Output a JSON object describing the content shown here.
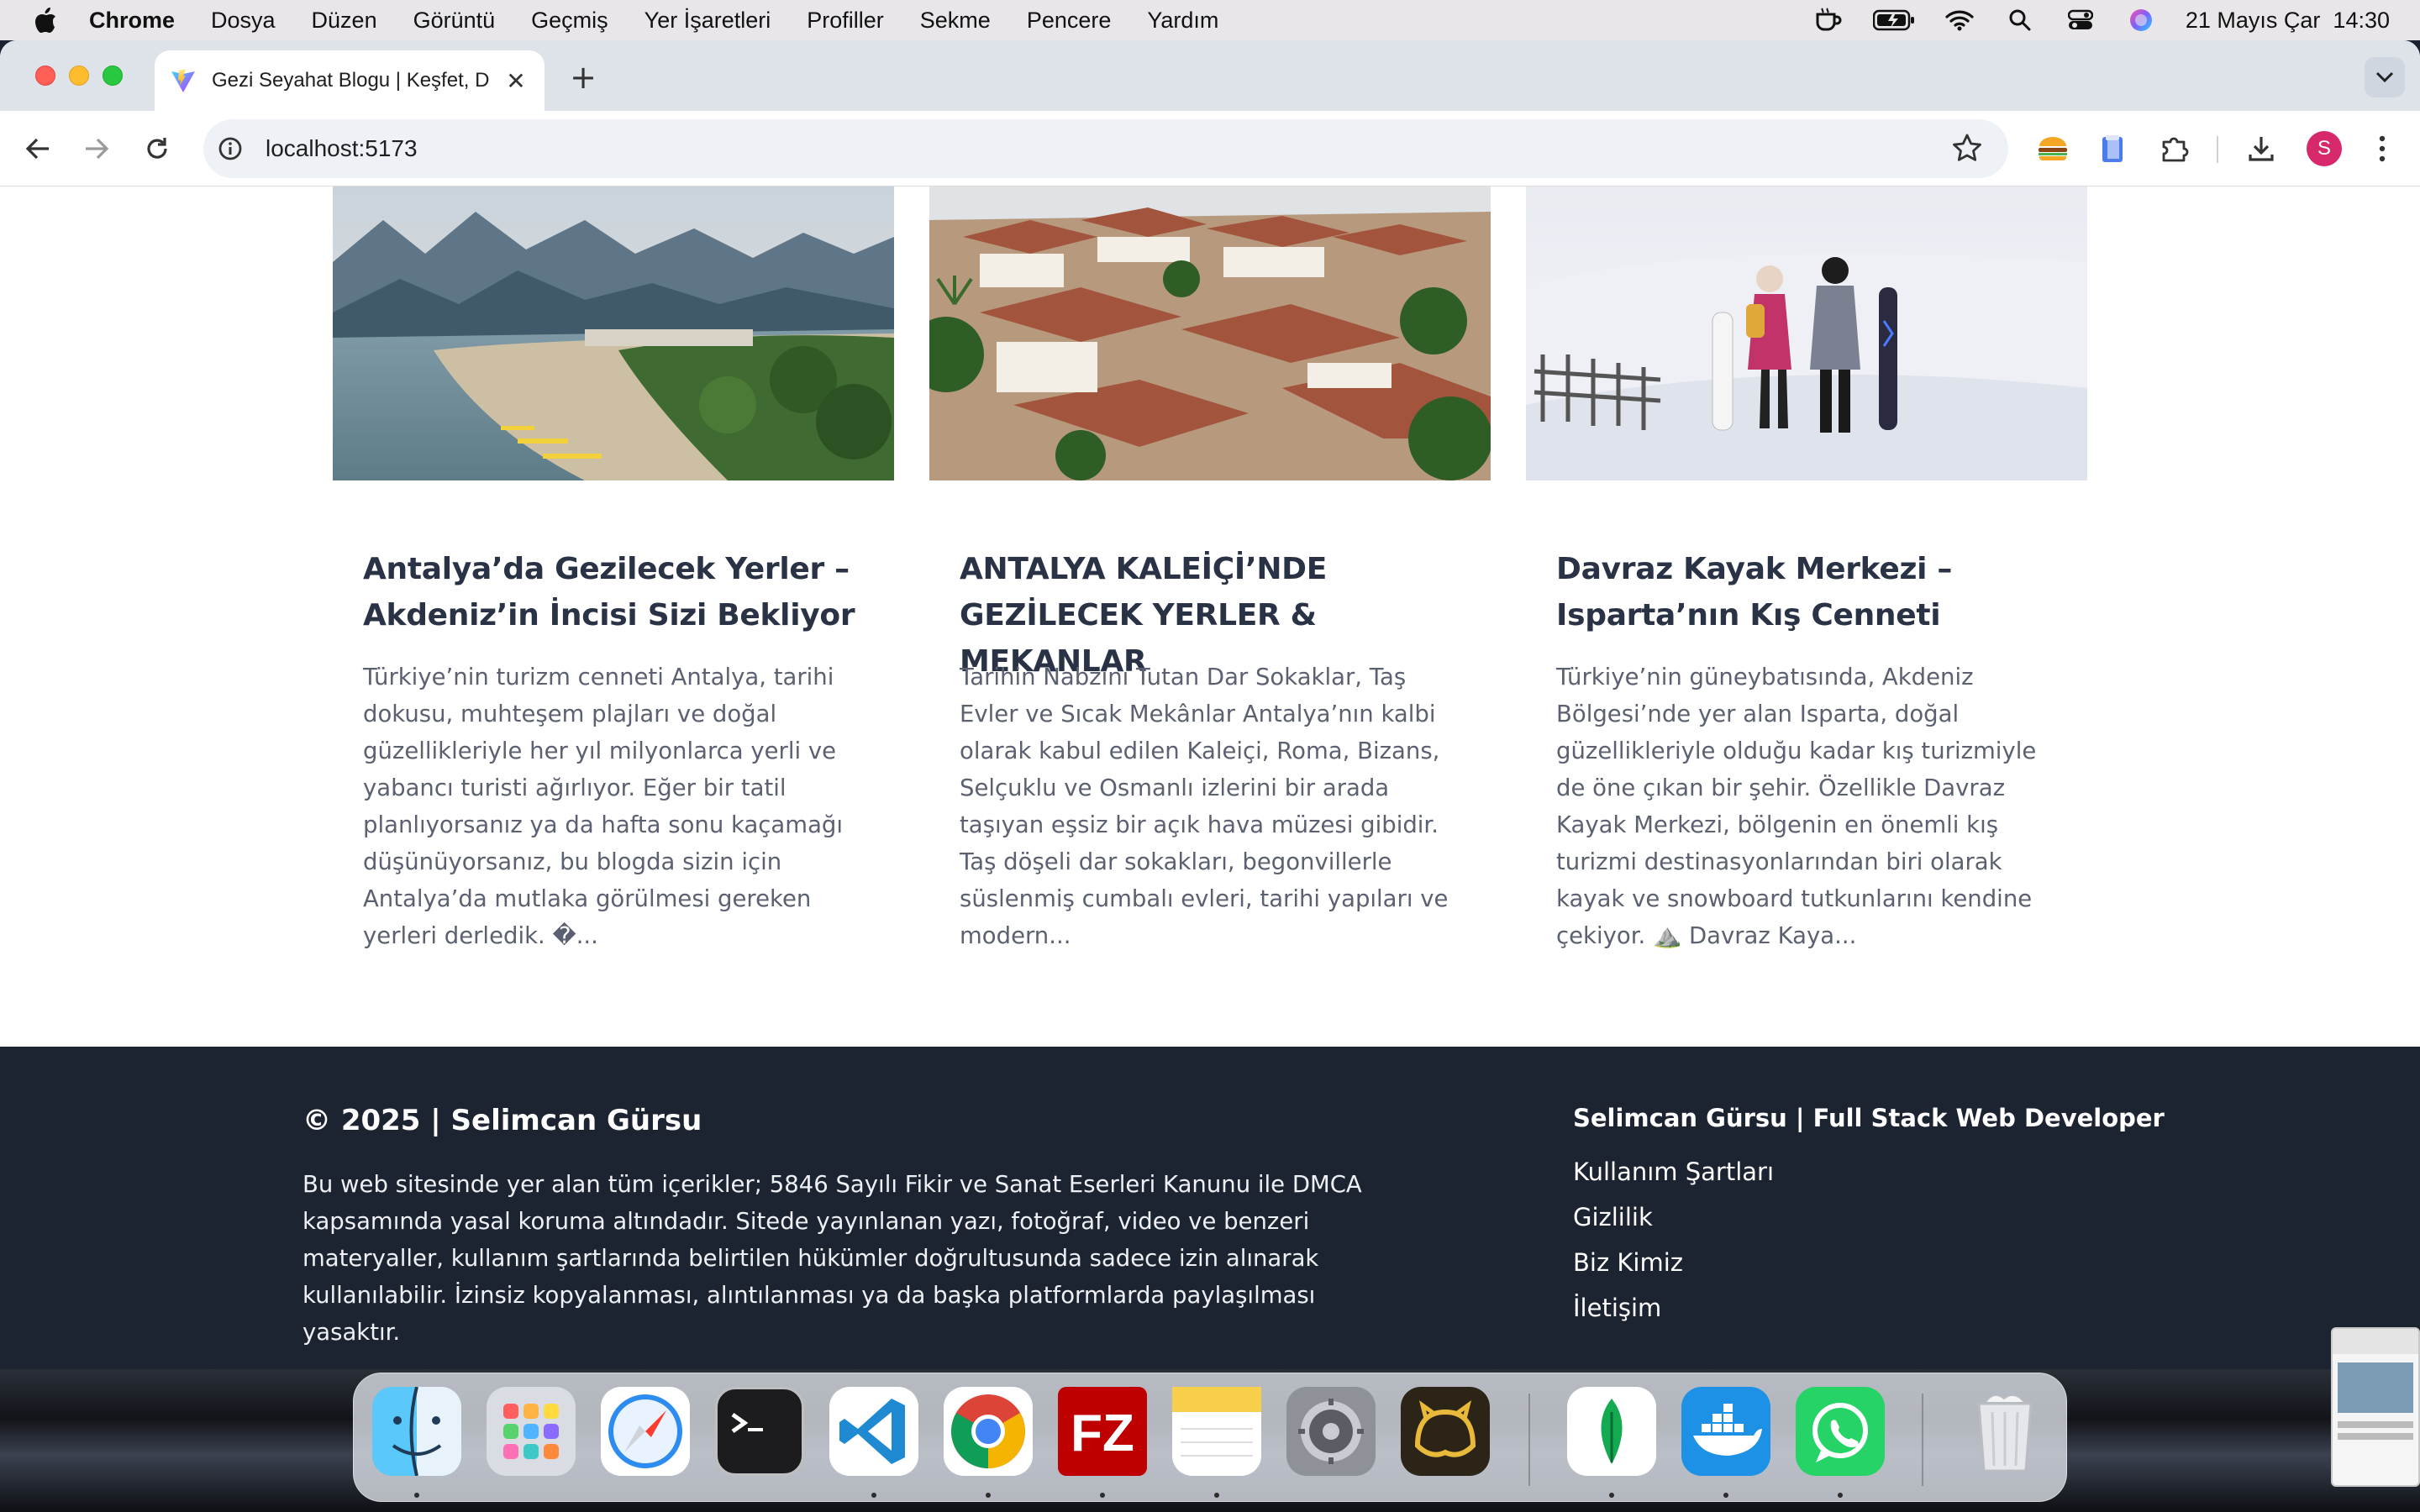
{
  "menubar": {
    "app": "Chrome",
    "items": [
      "Dosya",
      "Düzen",
      "Görüntü",
      "Geçmiş",
      "Yer İşaretleri",
      "Profiller",
      "Sekme",
      "Pencere",
      "Yardım"
    ],
    "datetime": "21 Mayıs Çar  14:30",
    "status_icons": [
      "coffee-cup-icon",
      "battery-icon",
      "wifi-icon",
      "search-icon",
      "control-center-icon",
      "siri-icon"
    ]
  },
  "browser": {
    "tab_title": "Gezi Seyahat Blogu | Keşfet, D",
    "url": "localhost:5173",
    "avatar_letter": "S"
  },
  "posts": [
    {
      "title": "Antalya’da Gezilecek Yerler – Akdeniz’in İncisi Sizi Bekliyor",
      "excerpt": "Türkiye’nin turizm cenneti Antalya, tarihi dokusu, muhteşem plajları ve doğal güzellikleriyle her yıl milyonlarca yerli ve yabancı turisti ağırlıyor. Eğer bir tatil planlıyorsanız ya da hafta sonu kaçamağı düşünüyorsanız, bu blogda sizin için Antalya’da mutlaka görülmesi gereken yerleri derledik. �..."
    },
    {
      "title": "ANTALYA KALEİÇİ’NDE GEZİLECEK YERLER & MEKANLAR",
      "excerpt": "Tarihin Nabzını Tutan Dar Sokaklar, Taş Evler ve Sıcak Mekânlar Antalya’nın kalbi olarak kabul edilen Kaleiçi, Roma, Bizans, Selçuklu ve Osmanlı izlerini bir arada taşıyan eşsiz bir açık hava müzesi gibidir. Taş döşeli dar sokakları, begonvillerle süslenmiş cumbalı evleri, tarihi yapıları ve modern..."
    },
    {
      "title": "Davraz Kayak Merkezi – Isparta’nın Kış Cenneti",
      "excerpt": "Türkiye’nin güneybatısında, Akdeniz Bölgesi’nde yer alan Isparta, doğal güzellikleriyle olduğu kadar kış turizmiyle de öne çıkan bir şehir. Özellikle Davraz Kayak Merkezi, bölgenin en önemli kış turizmi destinasyonlarından biri olarak kayak ve snowboard tutkunlarını kendine çekiyor. ⛰️ Davraz Kaya..."
    }
  ],
  "footer": {
    "copyright": "© 2025 | Selimcan Gürsu",
    "notice": "Bu web sitesinde yer alan tüm içerikler; 5846 Sayılı Fikir ve Sanat Eserleri Kanunu ile DMCA kapsamında yasal koruma altındadır. Sitede yayınlanan yazı, fotoğraf, video ve benzeri materyaller, kullanım şartlarında belirtilen hükümler doğrultusunda sadece izin alınarak kullanılabilir. İzinsiz kopyalanması, alıntılanması ya da başka platformlarda paylaşılması yasaktır.",
    "brand": "Selimcan Gürsu | Full Stack Web Developer",
    "links": [
      "Kullanım Şartları",
      "Gizlilik",
      "Biz Kimiz",
      "İletişim"
    ]
  },
  "dock": {
    "apps": [
      "finder-icon",
      "launchpad-icon",
      "safari-icon",
      "terminal-icon",
      "vscode-icon",
      "chrome-icon",
      "filezilla-icon",
      "notes-icon",
      "system-settings-icon",
      "navicat-icon",
      "mongodb-compass-icon",
      "docker-icon",
      "whatsapp-icon",
      "trash-icon"
    ]
  },
  "colors": {
    "footer_bg": "#1c2331",
    "title_color": "#2a3345",
    "body_color": "#5b6170"
  }
}
